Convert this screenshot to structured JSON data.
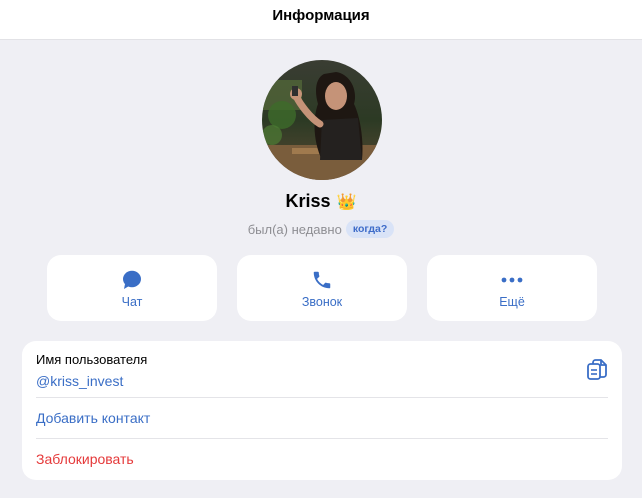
{
  "header": {
    "title": "Информация"
  },
  "profile": {
    "name": "Kriss",
    "badge_emoji": "👑",
    "status": "был(а) недавно",
    "when_badge": "когда?"
  },
  "actions": [
    {
      "label": "Чат",
      "icon": "chat-bubble-icon"
    },
    {
      "label": "Звонок",
      "icon": "phone-icon"
    },
    {
      "label": "Ещё",
      "icon": "more-dots-icon"
    }
  ],
  "info": {
    "username_label": "Имя пользователя",
    "username": "@kriss_invest",
    "add_contact": "Добавить контакт",
    "block": "Заблокировать"
  },
  "colors": {
    "accent": "#3a6ec6",
    "danger": "#e5393a",
    "background": "#efeff4"
  }
}
